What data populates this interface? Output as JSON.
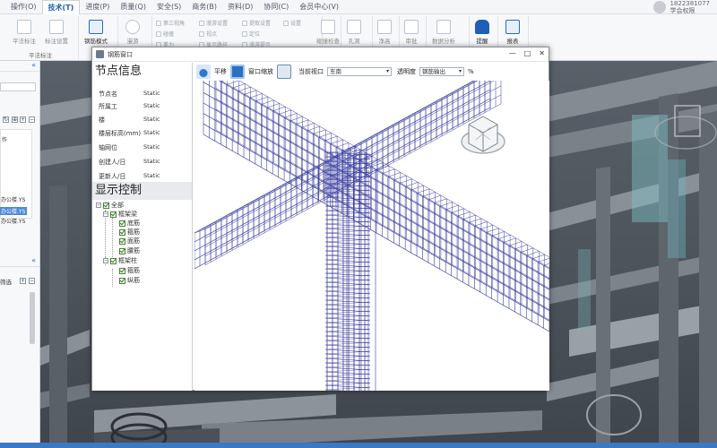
{
  "menubar": {
    "items": [
      {
        "label": "操作(O)",
        "active": false
      },
      {
        "label": "技术(T)",
        "active": true
      },
      {
        "label": "进度(P)",
        "active": false
      },
      {
        "label": "质量(Q)",
        "active": false
      },
      {
        "label": "安全(S)",
        "active": false
      },
      {
        "label": "商务(B)",
        "active": false
      },
      {
        "label": "资料(D)",
        "active": false
      },
      {
        "label": "协同(C)",
        "active": false
      },
      {
        "label": "会员中心(V)",
        "active": false
      }
    ],
    "account_line1": "1822381077",
    "account_line2": "学会权限"
  },
  "ribbon": {
    "buttons": [
      "平法标注",
      "标注设置",
      "钢筋模式",
      "漫游",
      "第三视角",
      "碰撞检查",
      "添加设置",
      "模型",
      "孔洞",
      "净高",
      "审批",
      "数据分析",
      "提醒",
      "报表"
    ],
    "small_items": [
      "碰撞",
      "重力",
      "漫游设置",
      "视点",
      "显示路径",
      "提取设置",
      "定位",
      "漫游提示",
      "设置"
    ],
    "group_label": "平法标注"
  },
  "left_panel": {
    "tree_rows": [
      "作",
      "办公楼.YS",
      "办公楼.YS",
      "办公楼.YS"
    ],
    "section2_label": "筛选"
  },
  "popup": {
    "title": "钢筋窗口",
    "controls": {
      "minimize": "—",
      "maximize": "□",
      "close": "✕"
    },
    "info_title": "节点信息",
    "info_rows": [
      {
        "key": "节点名",
        "value": "Static"
      },
      {
        "key": "所属工",
        "value": "Static"
      },
      {
        "key": "楼",
        "value": "Static"
      },
      {
        "key": "楼层标高(mm)",
        "value": "Static"
      },
      {
        "key": "轴网位",
        "value": "Static"
      },
      {
        "key": "创建人/日",
        "value": "Static"
      },
      {
        "key": "更新人/日",
        "value": "Static"
      }
    ],
    "display_title": "显示控制",
    "tree": {
      "root": "全部",
      "beam": "框架梁",
      "beam_children": [
        "底筋",
        "箍筋",
        "面筋",
        "腰筋"
      ],
      "column": "框架柱",
      "column_children": [
        "箍筋",
        "纵筋"
      ]
    },
    "toolbar": {
      "pan_label": "平移",
      "zoom_label": "窗口缩放",
      "view_label": "当前视口",
      "view_value": "东南",
      "opacity_label": "透明度",
      "opacity_value": "钢筋输出",
      "percent": "%"
    }
  },
  "colors": {
    "accent": "#1c5fb0",
    "rebar": "#3a3f9e",
    "tree_check": "#2e7a1e",
    "viewport_bg": "#4d535b",
    "selection": "#4a8ad6"
  }
}
